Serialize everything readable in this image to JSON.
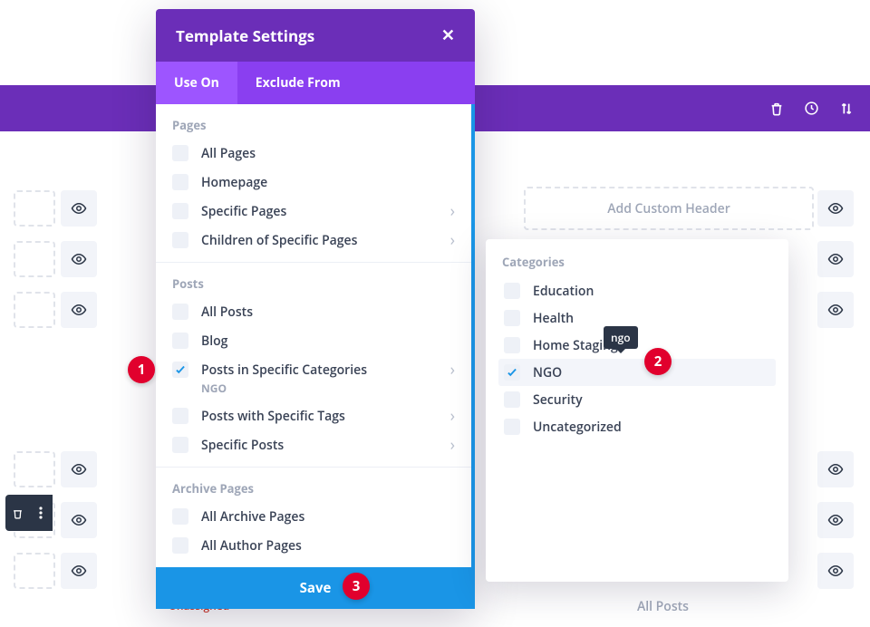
{
  "topbar": {
    "icons": [
      "trash-icon",
      "history-icon",
      "sort-icon"
    ]
  },
  "modal": {
    "title": "Template Settings",
    "tabs": {
      "use_on": "Use On",
      "exclude_from": "Exclude From"
    },
    "sections": {
      "pages": {
        "title": "Pages",
        "items": [
          {
            "label": "All Pages",
            "has_children": false
          },
          {
            "label": "Homepage",
            "has_children": false
          },
          {
            "label": "Specific Pages",
            "has_children": true
          },
          {
            "label": "Children of Specific Pages",
            "has_children": true
          }
        ]
      },
      "posts": {
        "title": "Posts",
        "items": [
          {
            "label": "All Posts",
            "has_children": false
          },
          {
            "label": "Blog",
            "has_children": false
          },
          {
            "label": "Posts in Specific Categories",
            "has_children": true,
            "checked": true,
            "sub": "NGO"
          },
          {
            "label": "Posts with Specific Tags",
            "has_children": true
          },
          {
            "label": "Specific Posts",
            "has_children": true
          }
        ]
      },
      "archive": {
        "title": "Archive Pages",
        "items": [
          {
            "label": "All Archive Pages",
            "has_children": false
          },
          {
            "label": "All Author Pages",
            "has_children": false
          }
        ]
      }
    },
    "save_label": "Save"
  },
  "flyout": {
    "title": "Categories",
    "tooltip": "ngo",
    "items": [
      {
        "label": "Education"
      },
      {
        "label": "Health"
      },
      {
        "label": "Home Staging"
      },
      {
        "label": "NGO",
        "checked": true
      },
      {
        "label": "Security"
      },
      {
        "label": "Uncategorized"
      }
    ]
  },
  "background": {
    "add_header": "Add Custom Header",
    "all_posts": "All Posts",
    "unassigned": "Unassigned"
  },
  "badges": {
    "b1": "1",
    "b2": "2",
    "b3": "3"
  }
}
